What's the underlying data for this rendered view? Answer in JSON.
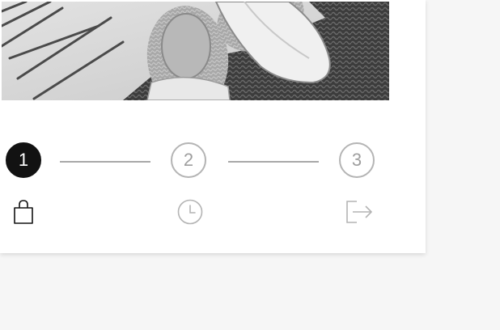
{
  "hero": {
    "image": "espadrille-slippers-photo"
  },
  "stepper": {
    "steps": [
      {
        "number": "1",
        "state": "active",
        "icon": "shopping-bag-icon"
      },
      {
        "number": "2",
        "state": "inactive",
        "icon": "clock-icon"
      },
      {
        "number": "3",
        "state": "inactive",
        "icon": "logout-icon"
      }
    ]
  },
  "colors": {
    "active": "#121212",
    "inactive": "#b4b4b4",
    "connector": "#a8a8a8",
    "background": "#f6f6f6",
    "card": "#ffffff"
  }
}
